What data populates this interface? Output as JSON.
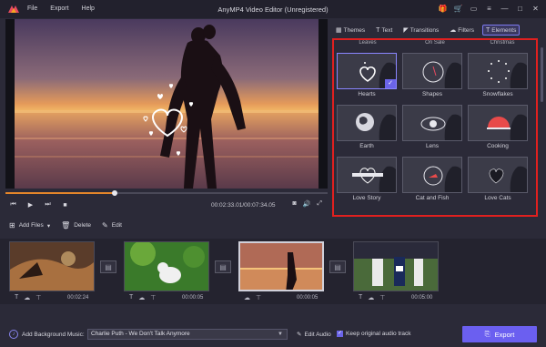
{
  "app": {
    "title": "AnyMP4 Video Editor (Unregistered)",
    "menu": [
      "File",
      "Export",
      "Help"
    ]
  },
  "player": {
    "timecode": "00:02:33.01/00:07:34.05",
    "progress": 0.34
  },
  "tabs": [
    {
      "label": "Themes",
      "icon": "themes-icon"
    },
    {
      "label": "Text",
      "icon": "text-icon"
    },
    {
      "label": "Transitions",
      "icon": "transitions-icon"
    },
    {
      "label": "Filters",
      "icon": "filters-icon"
    },
    {
      "label": "Elements",
      "icon": "elements-icon",
      "active": true
    }
  ],
  "elements": {
    "top_labels": [
      "Leaves",
      "On Sale",
      "Christmas"
    ],
    "items": [
      {
        "label": "Hearts",
        "selected": true
      },
      {
        "label": "Shapes"
      },
      {
        "label": "Snowflakes"
      },
      {
        "label": "Earth"
      },
      {
        "label": "Lens"
      },
      {
        "label": "Cooking"
      },
      {
        "label": "Love Story"
      },
      {
        "label": "Cat and Fish"
      },
      {
        "label": "Love Cats"
      }
    ]
  },
  "toolbar": {
    "add_files": "Add Files",
    "delete": "Delete",
    "edit": "Edit"
  },
  "timeline": {
    "clips": [
      {
        "duration": "00:02:24"
      },
      {
        "duration": "00:00:05"
      },
      {
        "duration": "00:00:05"
      },
      {
        "duration": "00:05:00"
      }
    ]
  },
  "bottom": {
    "bg_music_label": "Add Background Music:",
    "music_value": "Charlie Puth - We Don't Talk Anymore",
    "edit_audio": "Edit Audio",
    "keep_audio": "Keep original audio track",
    "export": "Export"
  },
  "colors": {
    "accent": "#6b5ff0",
    "highlight": "#e0201f",
    "progress": "#e5862a"
  }
}
